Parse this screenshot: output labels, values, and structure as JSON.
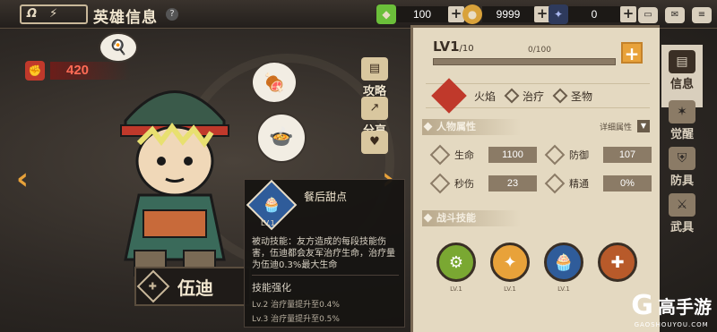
{
  "header": {
    "logo_text": "Ω",
    "title": "英雄信息",
    "help": "?"
  },
  "resources": [
    {
      "icon": "green-gem-icon",
      "value": "100",
      "color": "#6bbf3a"
    },
    {
      "icon": "gold-coin-icon",
      "value": "9999",
      "color": "#d9a23a"
    },
    {
      "icon": "crystal-icon",
      "value": "0",
      "color": "#7a8fd9"
    }
  ],
  "top_buttons": [
    "chat-icon",
    "mail-icon",
    "menu-icon"
  ],
  "power": {
    "value": "420"
  },
  "side_buttons": [
    {
      "label": "攻略",
      "icon": "book-icon"
    },
    {
      "label": "分享",
      "icon": "share-icon"
    },
    {
      "label": "",
      "icon": "heart-icon"
    }
  ],
  "hero": {
    "name": "伍迪"
  },
  "skill_tip": {
    "name": "餐后甜点",
    "level": "LV.1",
    "description": "被动技能：友方造成的每段技能伤害，伍迪都会友军治疗生命，治疗量为伍迪0.3%最大生命",
    "enhance_title": "技能强化",
    "levels": [
      "Lv.2  治疗量提升至0.4%",
      "Lv.3  治疗量提升至0.5%"
    ]
  },
  "panel": {
    "level": "LV1",
    "level_max": "/10",
    "exp": "0/100",
    "elements": [
      {
        "label": "火焰"
      },
      {
        "label": "治疗"
      },
      {
        "label": "圣物"
      }
    ],
    "attr_title": "人物属性",
    "detail_label": "详细属性",
    "stats": [
      {
        "label": "生命",
        "value": "1100"
      },
      {
        "label": "防御",
        "value": "107"
      },
      {
        "label": "秒伤",
        "value": "23"
      },
      {
        "label": "精通",
        "value": "0%"
      }
    ],
    "skills_title": "战斗技能",
    "skills": [
      {
        "level": "LV.1",
        "color": "#7aa832"
      },
      {
        "level": "LV.1",
        "color": "#e8a23a"
      },
      {
        "level": "LV.1",
        "color": "#2f5c9a"
      },
      {
        "level": "",
        "color": "#b85a2a"
      }
    ]
  },
  "tabs": [
    {
      "label": "信息",
      "active": true
    },
    {
      "label": "觉醒",
      "active": false
    },
    {
      "label": "防具",
      "active": false
    },
    {
      "label": "武具",
      "active": false
    }
  ],
  "watermark": {
    "logo": "G",
    "text": "高手游",
    "url": "GAOSHOUYOU.COM"
  }
}
